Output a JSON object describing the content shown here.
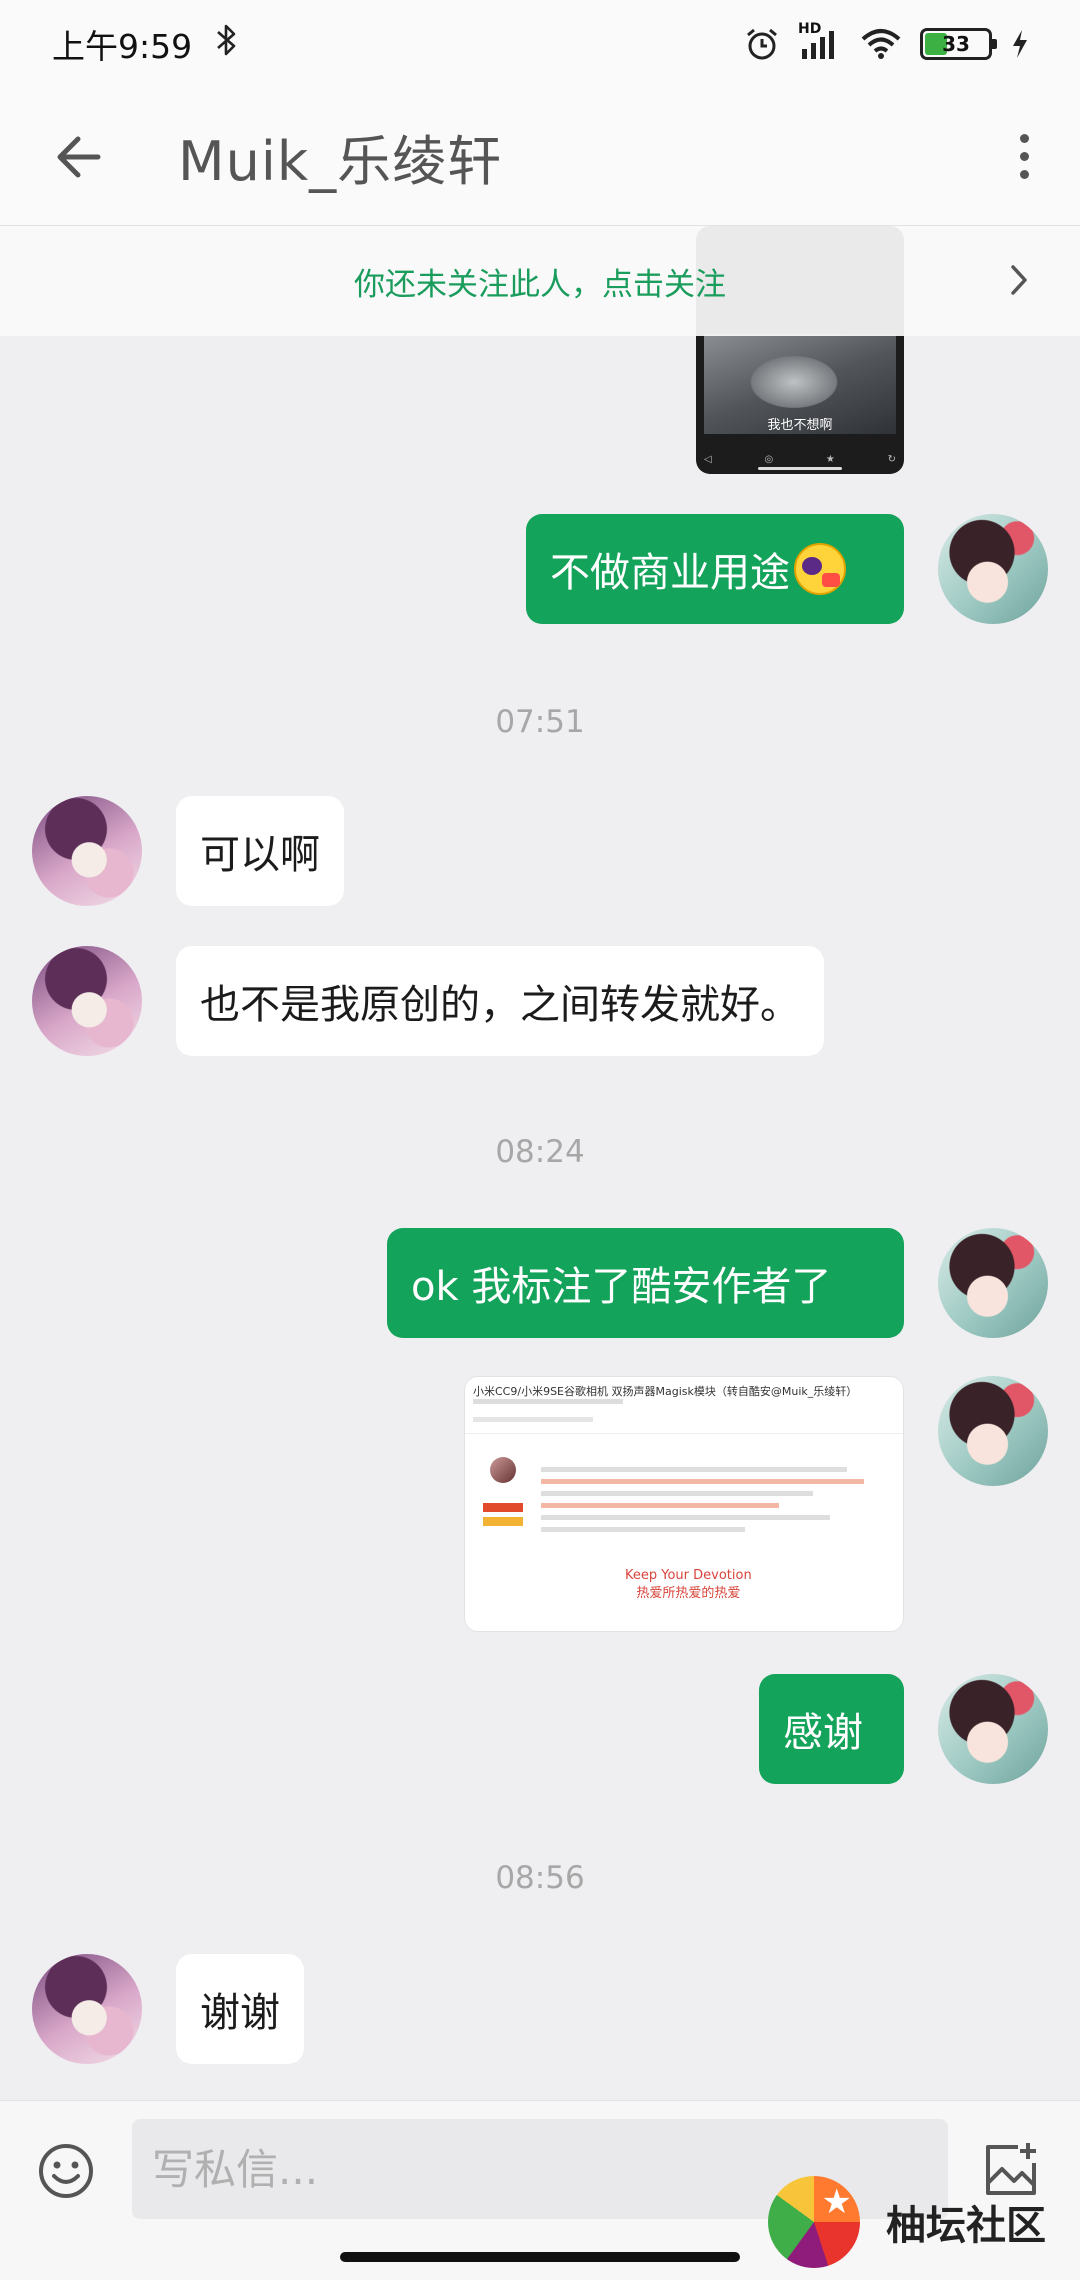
{
  "status_bar": {
    "time": "上午9:59",
    "network": "HD",
    "battery": "33"
  },
  "header": {
    "title": "Muik_乐绫轩"
  },
  "follow_banner": {
    "text": "你还未关注此人，点击关注"
  },
  "messages": {
    "img1_caption": "我也不想啊",
    "m1": "不做商业用途",
    "t1": "07:51",
    "m2": "可以啊",
    "m3": "也不是我原创的，之间转发就好。",
    "t2": "08:24",
    "m4": "ok 我标注了酷安作者了",
    "web_title": "小米CC9/小米9SE谷歌相机 双扬声器Magisk模块（转自酷安@Muik_乐绫轩）",
    "web_quote1": "Keep Your Devotion",
    "web_quote2": "热爱所热爱的热爱",
    "m5": "感谢",
    "t3": "08:56",
    "m6": "谢谢"
  },
  "input": {
    "placeholder": "写私信..."
  },
  "watermark": {
    "text": "柚坛社区"
  },
  "colors": {
    "accent_green": "#14a35a",
    "banner_text": "#1a9d5c"
  }
}
